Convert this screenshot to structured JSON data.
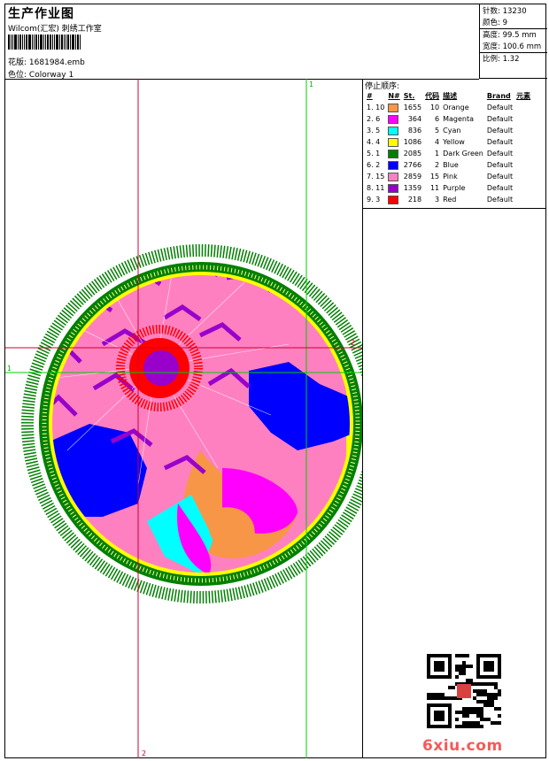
{
  "header": {
    "title": "生产作业图",
    "subtitle": "Wilcom(汇宏) 刺绣工作室",
    "design_label": "花版:",
    "design_file": "1681984.emb",
    "colorway_label": "色位:",
    "colorway": "Colorway 1"
  },
  "stats": {
    "stitches": "针数: 13230",
    "colors": "颜色: 9",
    "height": "高度: 99.5 mm",
    "width": "宽度: 100.6 mm",
    "scale": "比例: 1.32"
  },
  "guides": {
    "v_red": "2",
    "v_green": "1",
    "h_red": "2",
    "h_green": "1"
  },
  "panel": {
    "title": "停止顺序:",
    "headers": [
      "#",
      "N#",
      "St.",
      "代码",
      "描述",
      "Brand",
      "元素"
    ],
    "rows": [
      {
        "idx": "1. 10",
        "color": "#f79646",
        "st": "1655",
        "code": "10",
        "desc": "Orange",
        "brand": "Default"
      },
      {
        "idx": "2. 6",
        "color": "#ff00ff",
        "st": "364",
        "code": "6",
        "desc": "Magenta",
        "brand": "Default"
      },
      {
        "idx": "3. 5",
        "color": "#00ffff",
        "st": "836",
        "code": "5",
        "desc": "Cyan",
        "brand": "Default"
      },
      {
        "idx": "4. 4",
        "color": "#ffff00",
        "st": "1086",
        "code": "4",
        "desc": "Yellow",
        "brand": "Default"
      },
      {
        "idx": "5. 1",
        "color": "#008000",
        "st": "2085",
        "code": "1",
        "desc": "Dark Green",
        "brand": "Default"
      },
      {
        "idx": "6. 2",
        "color": "#0000ff",
        "st": "2766",
        "code": "2",
        "desc": "Blue",
        "brand": "Default"
      },
      {
        "idx": "7. 15",
        "color": "#ff80c0",
        "st": "2859",
        "code": "15",
        "desc": "Pink",
        "brand": "Default"
      },
      {
        "idx": "8. 11",
        "color": "#9900cc",
        "st": "1359",
        "code": "11",
        "desc": "Purple",
        "brand": "Default"
      },
      {
        "idx": "9. 3",
        "color": "#ff0000",
        "st": "218",
        "code": "3",
        "desc": "Red",
        "brand": "Default"
      }
    ]
  },
  "watermark": "6xiu.com"
}
